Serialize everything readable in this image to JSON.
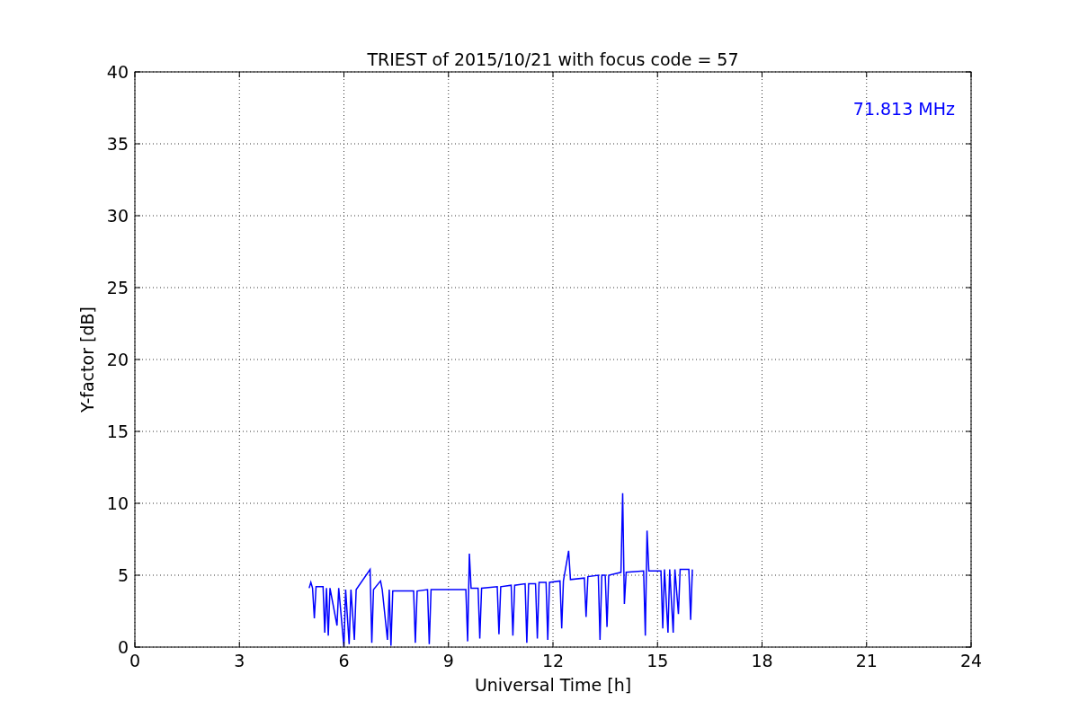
{
  "chart_data": {
    "type": "line",
    "title": "TRIEST of 2015/10/21 with focus code = 57",
    "xlabel": "Universal Time [h]",
    "ylabel": "Y-factor [dB]",
    "xlim": [
      0,
      24
    ],
    "ylim": [
      0,
      40
    ],
    "xticks": [
      0,
      3,
      6,
      9,
      12,
      15,
      18,
      21,
      24
    ],
    "yticks": [
      0,
      5,
      10,
      15,
      20,
      25,
      30,
      35,
      40
    ],
    "x": [
      5.0,
      5.05,
      5.1,
      5.15,
      5.2,
      5.4,
      5.45,
      5.5,
      5.55,
      5.6,
      5.8,
      5.85,
      6.0,
      6.05,
      6.15,
      6.2,
      6.3,
      6.35,
      6.75,
      6.8,
      6.85,
      7.05,
      7.1,
      7.25,
      7.3,
      7.35,
      7.4,
      8.0,
      8.05,
      8.1,
      8.4,
      8.45,
      8.5,
      9.3,
      9.5,
      9.55,
      9.6,
      9.65,
      9.85,
      9.9,
      9.95,
      10.4,
      10.45,
      10.5,
      10.8,
      10.85,
      10.9,
      11.2,
      11.25,
      11.3,
      11.5,
      11.55,
      11.6,
      11.8,
      11.85,
      11.9,
      12.2,
      12.25,
      12.3,
      12.45,
      12.5,
      12.9,
      12.95,
      13.0,
      13.3,
      13.35,
      13.4,
      13.5,
      13.55,
      13.6,
      13.95,
      14.0,
      14.05,
      14.1,
      14.6,
      14.65,
      14.7,
      14.75,
      15.1,
      15.15,
      15.2,
      15.3,
      15.35,
      15.45,
      15.5,
      15.6,
      15.65,
      15.9,
      15.95,
      16.0
    ],
    "series": [
      {
        "name": "71.813 MHz",
        "color": "#0000ff",
        "values": [
          4.1,
          4.5,
          4.1,
          2.0,
          4.2,
          4.2,
          1.0,
          4.1,
          0.8,
          4.1,
          1.5,
          4.1,
          0.0,
          4.0,
          0.2,
          4.0,
          0.5,
          4.0,
          5.4,
          0.3,
          4.0,
          4.6,
          4.0,
          0.5,
          4.0,
          0.1,
          3.9,
          3.9,
          0.3,
          3.9,
          4.0,
          0.2,
          4.0,
          4.0,
          4.0,
          0.4,
          6.5,
          4.1,
          4.1,
          0.6,
          4.1,
          4.2,
          0.9,
          4.2,
          4.3,
          0.8,
          4.3,
          4.4,
          0.3,
          4.4,
          4.4,
          0.6,
          4.5,
          4.5,
          0.5,
          4.5,
          4.6,
          1.3,
          4.6,
          6.7,
          4.7,
          4.8,
          2.1,
          4.9,
          5.0,
          0.5,
          5.0,
          5.0,
          1.4,
          5.0,
          5.2,
          10.7,
          3.0,
          5.2,
          5.3,
          0.8,
          8.1,
          5.3,
          5.3,
          1.3,
          5.4,
          1.0,
          5.4,
          1.0,
          5.4,
          2.3,
          5.4,
          5.4,
          1.9,
          5.4
        ]
      }
    ],
    "grid": true
  }
}
